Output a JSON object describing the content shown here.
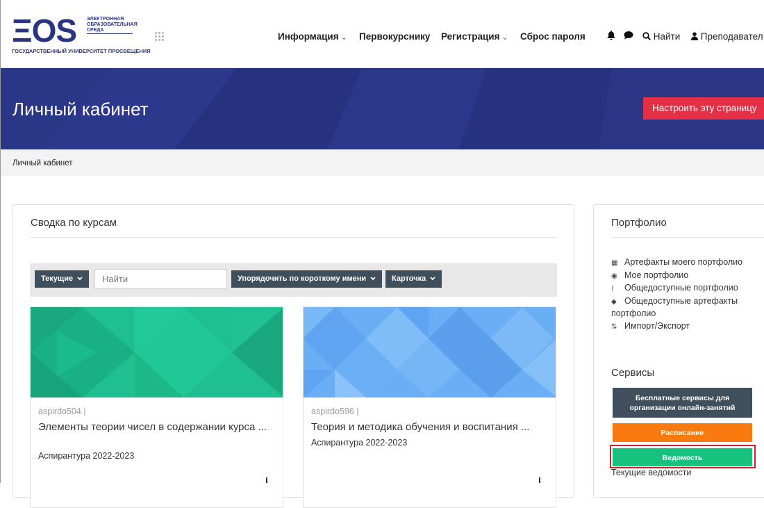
{
  "header": {
    "logo": {
      "mark": "ΞOS",
      "line1": "ЭЛЕКТРОННАЯ",
      "line2": "ОБРАЗОВАТЕЛЬНАЯ",
      "line3": "СРЕДА",
      "subtitle": "ГОСУДАРСТВЕННЫЙ УНИВЕРСИТЕТ ПРОСВЕЩЕНИЯ",
      "color": "#2b3481"
    },
    "nav": [
      {
        "label": "Информация",
        "has_dropdown": true
      },
      {
        "label": "Первокурснику",
        "has_dropdown": false
      },
      {
        "label": "Регистрация",
        "has_dropdown": true
      },
      {
        "label": "Сброс пароля",
        "has_dropdown": false
      }
    ],
    "search_label": "Найти",
    "user_label": "Преподавател",
    "icons": [
      "bell-icon",
      "chat-icon",
      "search-icon",
      "user-icon",
      "apps-grid-icon"
    ]
  },
  "banner": {
    "title": "Личный кабинет",
    "customize_button": "Настроить эту страницу",
    "bg_color": "#27327f",
    "button_color": "#e42f45"
  },
  "breadcrumb": "Личный кабинет",
  "course_overview": {
    "title": "Сводка по курсам",
    "filter_label": "Текущие",
    "search_placeholder": "Найти",
    "sort_label": "Упорядочить по короткому имени",
    "view_label": "Карточка",
    "courses": [
      {
        "shortname": "aspirdo504 |",
        "name": "Элементы теории чисел в содержании курса ...",
        "category": "Аспирантура 2022-2023",
        "image_color": "#1fbf8f"
      },
      {
        "shortname": "aspirdo596 |",
        "name": "Теория и методика обучения и воспитания ...",
        "category": "Аспирантура 2022-2023",
        "image_color": "#6aaef5"
      }
    ]
  },
  "portfolio": {
    "title": "Портфолио",
    "items": [
      {
        "icon": "artefacts-icon",
        "label": "Артефакты моего портфолио"
      },
      {
        "icon": "eye-icon",
        "label": "Мое портфолио"
      },
      {
        "icon": "share-icon",
        "label": "Общедоступные портфолио"
      },
      {
        "icon": "tag-icon",
        "label": "Общедоступные артефакты портфолио"
      },
      {
        "icon": "import-export-icon",
        "label": "Импорт/Экспорт"
      }
    ]
  },
  "services": {
    "title": "Сервисы",
    "buttons": [
      {
        "label": "Бесплатные сервисы для организации онлайн-занятий",
        "color": "#3f4f5b"
      },
      {
        "label": "Расписание",
        "color": "#f97a0f"
      },
      {
        "label": "Ведомость",
        "color": "#17c17e"
      }
    ],
    "current_sheets": "Текущие ведомости"
  }
}
